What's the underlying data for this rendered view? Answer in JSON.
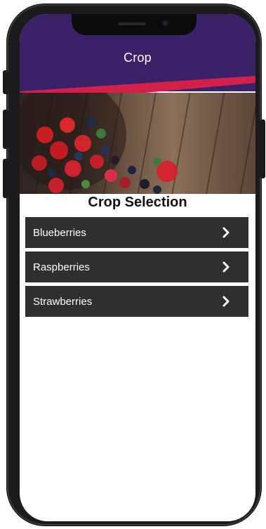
{
  "header": {
    "title": "Crop",
    "color": "#3a2168",
    "accent": "#d3204a"
  },
  "page": {
    "section_title": "Crop Selection"
  },
  "crops": [
    {
      "label": "Blueberries",
      "icon": "chevron-right-icon"
    },
    {
      "label": "Raspberries",
      "icon": "chevron-right-icon"
    },
    {
      "label": "Strawberries",
      "icon": "chevron-right-icon"
    }
  ],
  "colors": {
    "list_bg": "#2f2f2f",
    "text": "#ffffff"
  }
}
